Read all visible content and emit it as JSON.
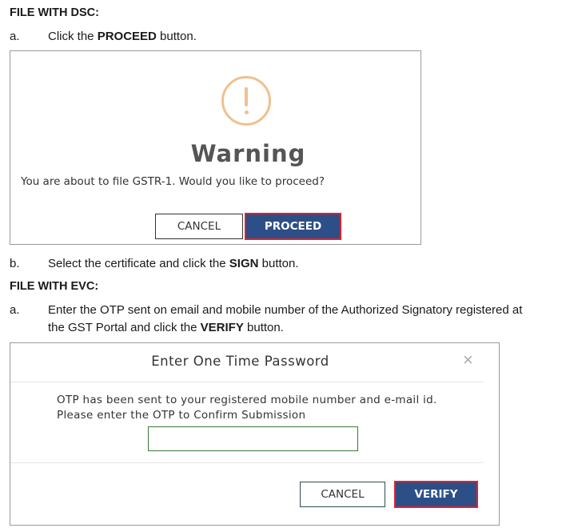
{
  "dsc": {
    "heading": "FILE WITH DSC:",
    "step_a": {
      "letter": "a.",
      "pre": "Click the ",
      "bold": "PROCEED",
      "post": " button."
    },
    "dialog": {
      "title": "Warning",
      "message": "You are about to file GSTR-1. Would you like to proceed?",
      "cancel_label": "CANCEL",
      "proceed_label": "PROCEED",
      "icon": "exclamation-circle-icon",
      "icon_color": "#f0c08e"
    },
    "step_b": {
      "letter": "b.",
      "pre": "Select the certificate and click the ",
      "bold": "SIGN",
      "post": " button."
    }
  },
  "evc": {
    "heading": "FILE WITH EVC:",
    "step_a": {
      "letter": "a.",
      "line1": "Enter the OTP sent on email and mobile number of the Authorized Signatory registered at",
      "line2_pre": "the GST Portal and click the ",
      "bold": "VERIFY",
      "post": " button."
    },
    "dialog": {
      "title": "Enter One Time Password",
      "close_glyph": "×",
      "message_line1": "OTP has been sent to your registered mobile number and e-mail id.",
      "message_line2": "Please enter the OTP to Confirm Submission",
      "otp_value": "",
      "cancel_label": "CANCEL",
      "verify_label": "VERIFY"
    }
  },
  "colors": {
    "primary": "#2c4f87",
    "highlight": "#e0212e",
    "input_border": "#3a7a3a"
  }
}
